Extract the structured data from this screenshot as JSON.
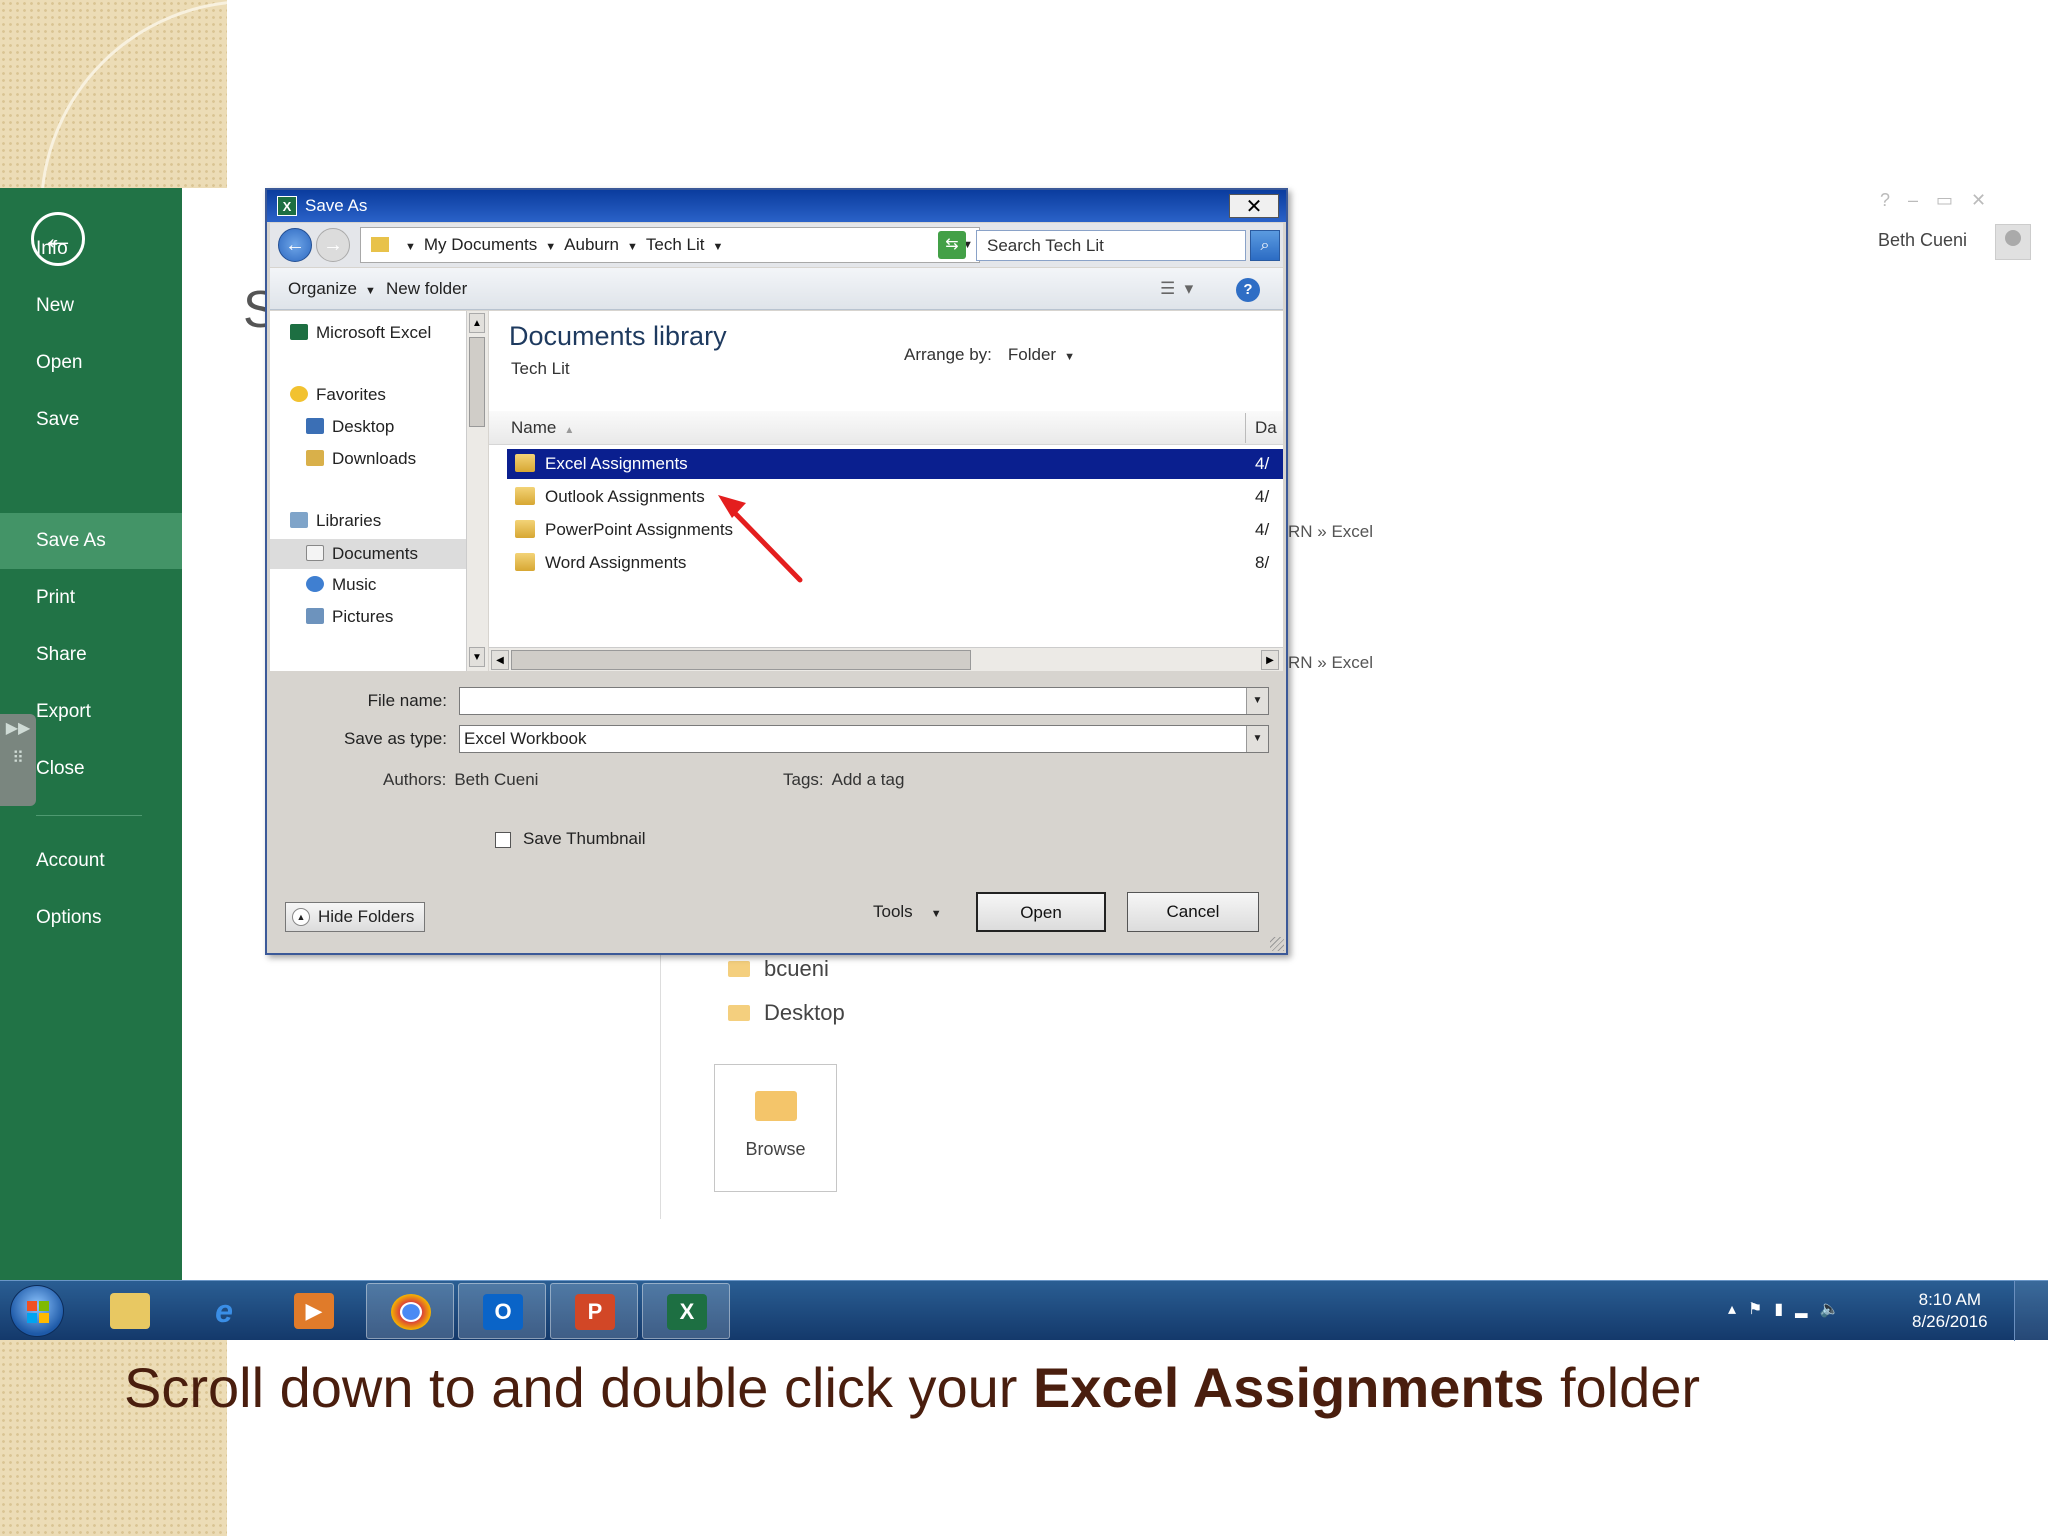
{
  "slide": {
    "caption_before": "Scroll down to and double click your ",
    "caption_bold": "Excel Assignments",
    "caption_after": " folder"
  },
  "backstage": {
    "items": [
      "Info",
      "New",
      "Open",
      "Save",
      "Save As",
      "Print",
      "Share",
      "Export",
      "Close",
      "Account",
      "Options"
    ],
    "active": "Save As",
    "bg_title_fragment": "S",
    "recent_path_1": "RN » Excel",
    "recent_path_2": "RN » Excel",
    "user_name": "Beth Cueni",
    "locations": [
      "bcueni",
      "Desktop"
    ],
    "browse_label": "Browse"
  },
  "dialog": {
    "title": "Save As",
    "breadcrumbs": [
      "My Documents",
      "Auburn",
      "Tech Lit"
    ],
    "search_placeholder": "Search Tech Lit",
    "toolbar": {
      "organize": "Organize",
      "new_folder": "New folder"
    },
    "nav": {
      "app": "Microsoft Excel",
      "favorites": "Favorites",
      "favorites_items": [
        "Desktop",
        "Downloads"
      ],
      "libraries": "Libraries",
      "libraries_items": [
        "Documents",
        "Music",
        "Pictures"
      ]
    },
    "library_title": "Documents library",
    "library_sub": "Tech Lit",
    "arrange_label": "Arrange by:",
    "arrange_value": "Folder",
    "columns": {
      "name": "Name",
      "date": "Da"
    },
    "files": [
      {
        "name": "Excel Assignments",
        "date": "4/",
        "selected": true
      },
      {
        "name": "Outlook Assignments",
        "date": "4/",
        "selected": false
      },
      {
        "name": "PowerPoint Assignments",
        "date": "4/",
        "selected": false
      },
      {
        "name": "Word Assignments",
        "date": "8/",
        "selected": false
      }
    ],
    "file_name_label": "File name:",
    "file_name_value": "",
    "save_type_label": "Save as type:",
    "save_type_value": "Excel Workbook",
    "authors_label": "Authors:",
    "authors_value": "Beth Cueni",
    "tags_label": "Tags:",
    "tags_value": "Add a tag",
    "save_thumbnail": "Save Thumbnail",
    "hide_folders": "Hide Folders",
    "tools": "Tools",
    "open": "Open",
    "cancel": "Cancel"
  },
  "taskbar": {
    "apps": [
      "explorer",
      "internet-explorer",
      "media-player",
      "chrome",
      "outlook",
      "powerpoint",
      "excel"
    ],
    "time": "8:10 AM",
    "date": "8/26/2016"
  },
  "colors": {
    "excel_green": "#217346",
    "selection_blue": "#0a1f8f",
    "caption_brown": "#4a1e0e",
    "annotation_red": "#e41e1e"
  }
}
